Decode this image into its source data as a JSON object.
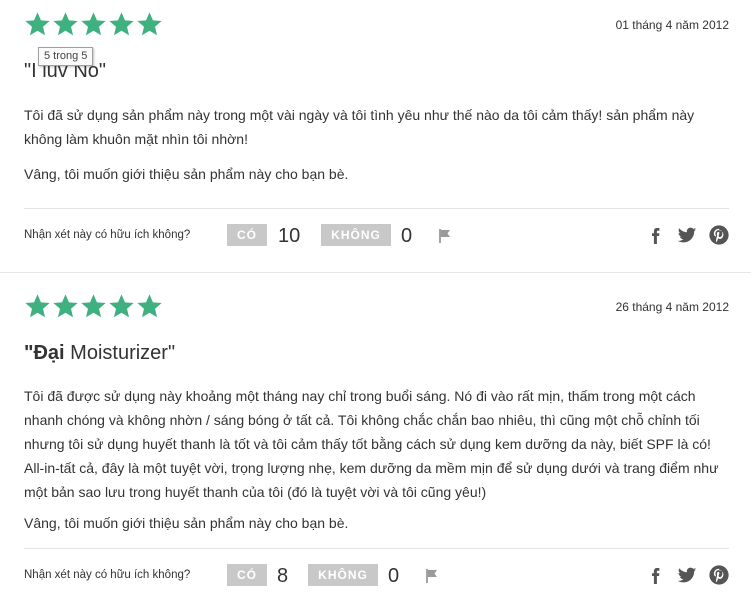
{
  "reviews": [
    {
      "rating": 5,
      "date": "01 tháng 4 năm 2012",
      "title": "\"I luv No\"",
      "body": "Tôi đã sử dụng sản phẩm này trong một vài ngày và tôi tình yêu như thế nào da tôi cảm thấy! sản phẩm này không làm khuôn mặt nhìn tôi nhờn!",
      "recommend": "Vâng, tôi muốn giới thiệu sản phẩm này cho bạn bè.",
      "helpful_question": "Nhận xét này có hữu ích không?",
      "yes_label": "CÓ",
      "yes_count": "10",
      "no_label": "KHÔNG",
      "no_count": "0"
    },
    {
      "rating": 5,
      "date": "26 tháng 4 năm 2012",
      "title_bold": "\"Đại",
      "title_rest": " Moisturizer\"",
      "body": "Tôi đã được sử dụng này khoảng một tháng nay chỉ trong buổi sáng. Nó đi vào rất mịn, thấm trong một cách nhanh chóng và không nhờn / sáng bóng ở tất cả. Tôi không chắc chắn bao nhiêu, thì cũng một chỗ chỉnh tối nhưng tôi sử dụng huyết thanh là tốt và tôi cảm thấy tốt bằng cách sử dụng kem dưỡng da này, biết SPF là có! All-in-tất cả, đây là một tuyệt vời, trọng lượng nhẹ, kem dưỡng da mềm mịn để sử dụng dưới và trang điểm như một bản sao lưu trong huyết thanh của tôi (đó là tuyệt vời và tôi cũng yêu!)",
      "recommend": "Vâng, tôi muốn giới thiệu sản phẩm này cho bạn bè.",
      "helpful_question": "Nhận xét này có hữu ích không?",
      "yes_label": "CÓ",
      "yes_count": "8",
      "no_label": "KHÔNG",
      "no_count": "0"
    }
  ],
  "tooltip": "5 trong 5",
  "colors": {
    "star": "#3fb07f",
    "button": "#c8c8c8",
    "icon": "#555555"
  },
  "icons": {
    "star": "star-icon",
    "flag": "flag-icon",
    "facebook": "facebook-icon",
    "twitter": "twitter-icon",
    "pinterest": "pinterest-icon"
  }
}
